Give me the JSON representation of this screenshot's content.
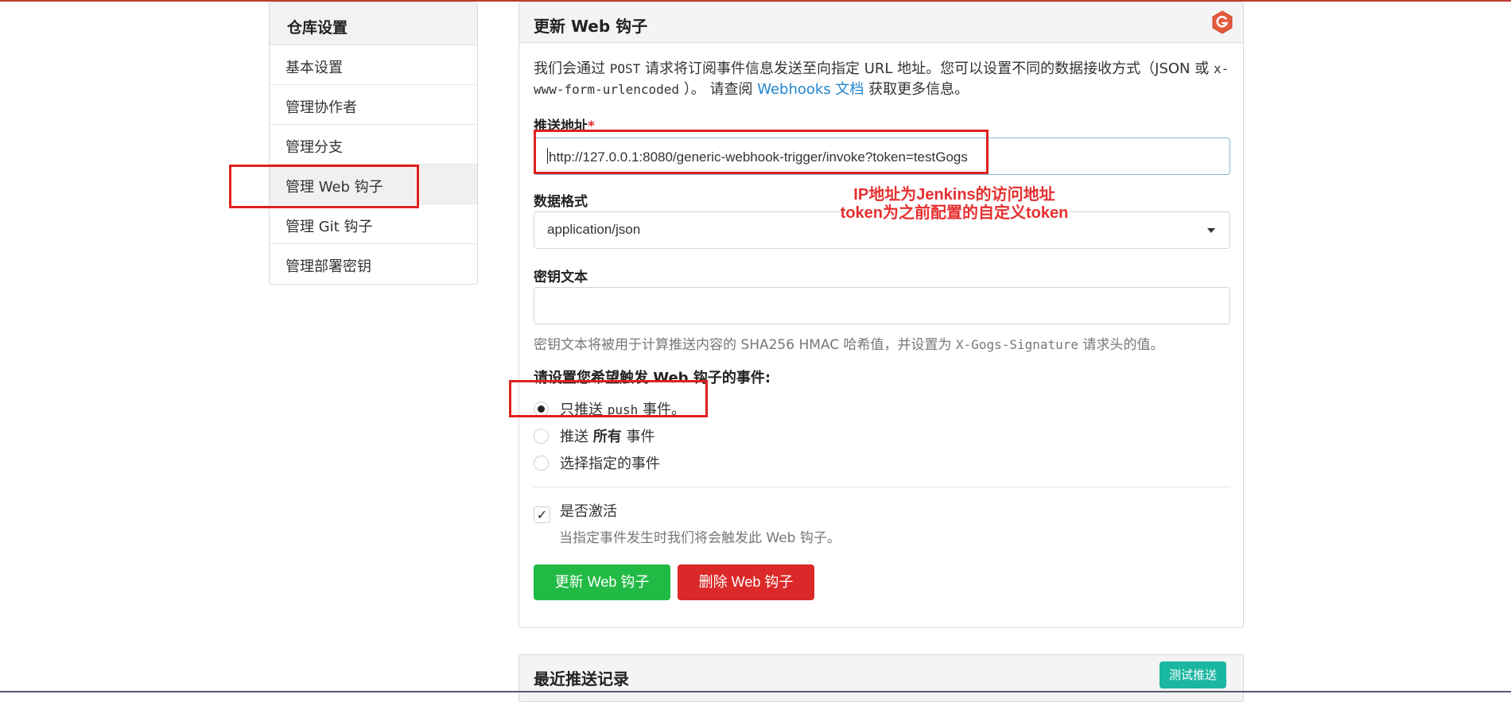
{
  "sidebar": {
    "title": "仓库设置",
    "items": [
      {
        "label": "基本设置"
      },
      {
        "label": "管理协作者"
      },
      {
        "label": "管理分支"
      },
      {
        "label": "管理 Web 钩子"
      },
      {
        "label": "管理 Git 钩子"
      },
      {
        "label": "管理部署密钥"
      }
    ]
  },
  "main": {
    "title": "更新 Web 钩子",
    "desc": {
      "p1": "我们会通过",
      "post": "POST",
      "p2": "请求将订阅事件信息发送至向指定 URL 地址。您可以设置不同的数据接收方式（JSON 或",
      "xform": "x-www-form-urlencoded",
      "p3": "）。 请查阅",
      "link": "Webhooks 文档",
      "p4": "获取更多信息。"
    },
    "payload_url": {
      "label": "推送地址",
      "required_mark": "*",
      "value": "http://127.0.0.1:8080/generic-webhook-trigger/invoke?token=testGogs"
    },
    "content_type": {
      "label": "数据格式",
      "selected": "application/json"
    },
    "secret": {
      "label": "密钥文本",
      "value": "",
      "help_p1": "密钥文本将被用于计算推送内容的 SHA256 HMAC 哈希值，并设置为",
      "help_header": "X-Gogs-Signature",
      "help_p2": "请求头的值。"
    },
    "events": {
      "title": "请设置您希望触发 Web 钩子的事件:",
      "options": [
        {
          "pre": "只推送",
          "code": "push",
          "post": "事件。",
          "checked": true
        },
        {
          "pre": "推送",
          "bold": "所有",
          "post": "事件",
          "checked": false
        },
        {
          "pre": "选择指定的事件",
          "checked": false
        }
      ]
    },
    "active": {
      "label": "是否激活",
      "checked": true,
      "help": "当指定事件发生时我们将会触发此 Web 钩子。"
    },
    "update_button": "更新 Web 钩子",
    "delete_button": "删除 Web 钩子"
  },
  "annotation": {
    "line1": "IP地址为Jenkins的访问地址",
    "line2": "token为之前配置的自定义token"
  },
  "recent": {
    "title": "最近推送记录",
    "test_button": "测试推送"
  },
  "colors": {
    "green": "#21ba45",
    "red": "#db2828",
    "teal": "#1ab7a0",
    "link": "#2185d0",
    "annotation": "#e02020"
  },
  "icons": {
    "logo": "gogs-logo",
    "dropdown": "dropdown-arrow-icon",
    "checkmark": "check-icon"
  }
}
